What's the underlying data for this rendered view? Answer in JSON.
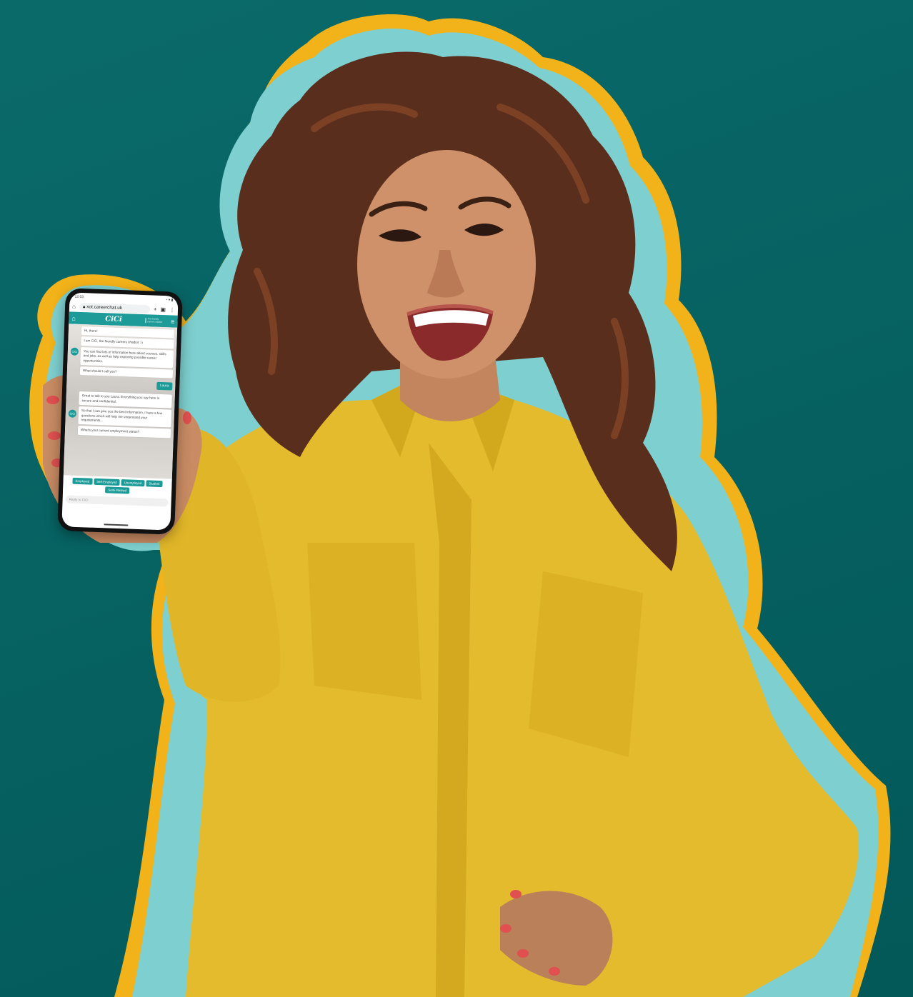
{
  "scene": {
    "background": "#076262",
    "outline_colors": [
      "#f2b21a",
      "#7ecfcf"
    ],
    "shirt_color": "#e4bb2c"
  },
  "phone": {
    "status_time": "12:03",
    "url": "xot.careerchat.uk",
    "brand": "CiCi",
    "brand_tagline": "The friendly careers chatbot",
    "messages_group1": [
      "Hi, there!",
      "I am CiCi, the friendly careers chatbot :-)",
      "You can find lots of information here about courses, skills and jobs, as well as help exploring possible career opportunities.",
      "What should I call you?"
    ],
    "avatar_label": "CiCi",
    "user_reply": "Laura",
    "messages_group2": [
      "Great to talk to you Laura. Everything you say here is secure and confidential.",
      "So that I can give you the best information, I have a few questions which will help me understand your requirements...",
      "What's your current employment status?"
    ],
    "options": [
      "Employed",
      "Self-Employed",
      "Unemployed",
      "Student",
      "Semi-Retired"
    ],
    "reply_placeholder": "Reply to CiCi"
  }
}
